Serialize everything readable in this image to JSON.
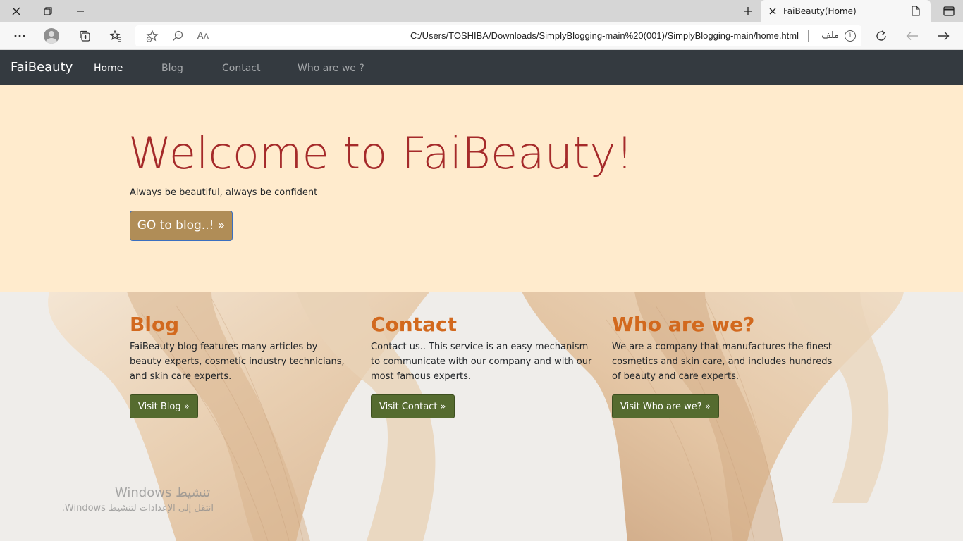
{
  "browser": {
    "tab_title": "FaiBeauty(Home)",
    "address_url": "C:/Users/TOSHIBA/Downloads/SimplyBlogging-main%20(001)/SimplyBlogging-main/home.html",
    "file_label": "ملف",
    "info_glyph": "i",
    "read_aloud_label": "Aᴀ"
  },
  "navbar": {
    "brand": "FaiBeauty",
    "links": [
      {
        "label": "Home",
        "active": true
      },
      {
        "label": "Blog",
        "active": false
      },
      {
        "label": "Contact",
        "active": false
      },
      {
        "label": "Who are we ?",
        "active": false
      }
    ]
  },
  "hero": {
    "title": "Welcome to FaiBeauty!",
    "subtitle": "Always be beautiful, always be confident",
    "button_label": "GO to blog..! »"
  },
  "columns": [
    {
      "title": "Blog",
      "text": "FaiBeauty blog features many articles by beauty experts, cosmetic industry technicians, and skin care experts.",
      "button_label": "Visit Blog »"
    },
    {
      "title": "Contact",
      "text": "Contact us.. This service is an easy mechanism to communicate with our company and with our most famous experts.",
      "button_label": "Visit Contact »"
    },
    {
      "title": "Who are we?",
      "text": "We are a company that manufactures the finest cosmetics and skin care, and includes hundreds of beauty and care experts.",
      "button_label": "Visit Who are we? »"
    }
  ],
  "watermark": {
    "line1": "Windows تنشيط",
    "line2": "انتقل إلى الإعدادات لتنشيط Windows."
  },
  "colors": {
    "navbar_bg": "#343a40",
    "hero_bg": "#ffebcd",
    "hero_title": "#a52a2a",
    "hero_button": "#b08d57",
    "column_title": "#d2691e",
    "column_button": "#556b2f"
  }
}
